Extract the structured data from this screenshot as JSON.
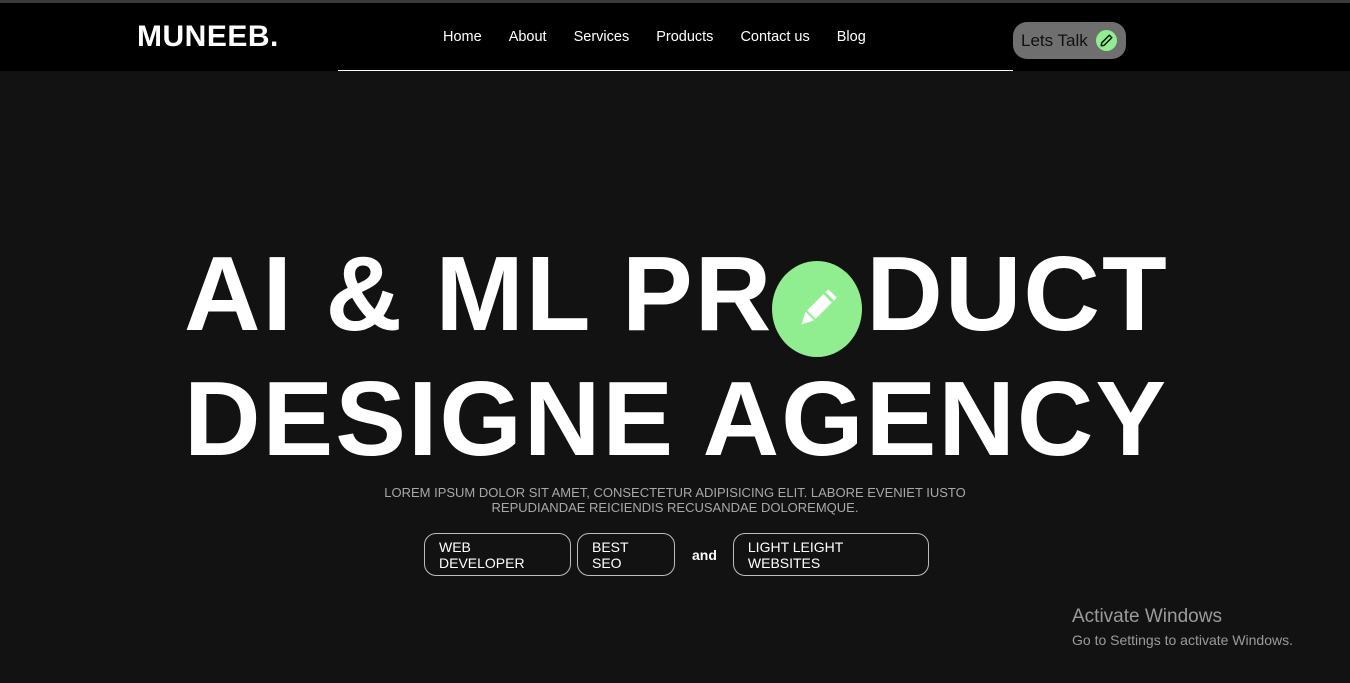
{
  "navbar": {
    "logo": "MUNEEB.",
    "links": [
      "Home",
      "About",
      "Services",
      "Products",
      "Contact us",
      "Blog"
    ],
    "cta_label": "Lets Talk",
    "cta_icon": "pencil-icon"
  },
  "hero": {
    "line1_part1": "AI & ML PR",
    "line1_part2": "DUCT",
    "line2": "DESIGNE AGENCY",
    "center_icon": "pencil-icon",
    "subtitle_line1": "LOREM IPSUM DOLOR SIT AMET, CONSECTETUR ADIPISICING ELIT. LABORE EVENIET IUSTO",
    "subtitle_line2": "REPUDIANDAE REICIENDIS RECUSANDAE DOLOREMQUE.",
    "tags": [
      "WEB DEVELOPER",
      "BEST SEO",
      "LIGHT LEIGHT WEBSITES"
    ],
    "tag_joiner": "and"
  },
  "watermark": {
    "title": "Activate Windows",
    "subtitle": "Go to Settings to activate Windows."
  },
  "colors": {
    "background": "#121212",
    "navbar": "#000000",
    "accent": "#90ee90",
    "cta_bg": "#6f6f6f"
  }
}
